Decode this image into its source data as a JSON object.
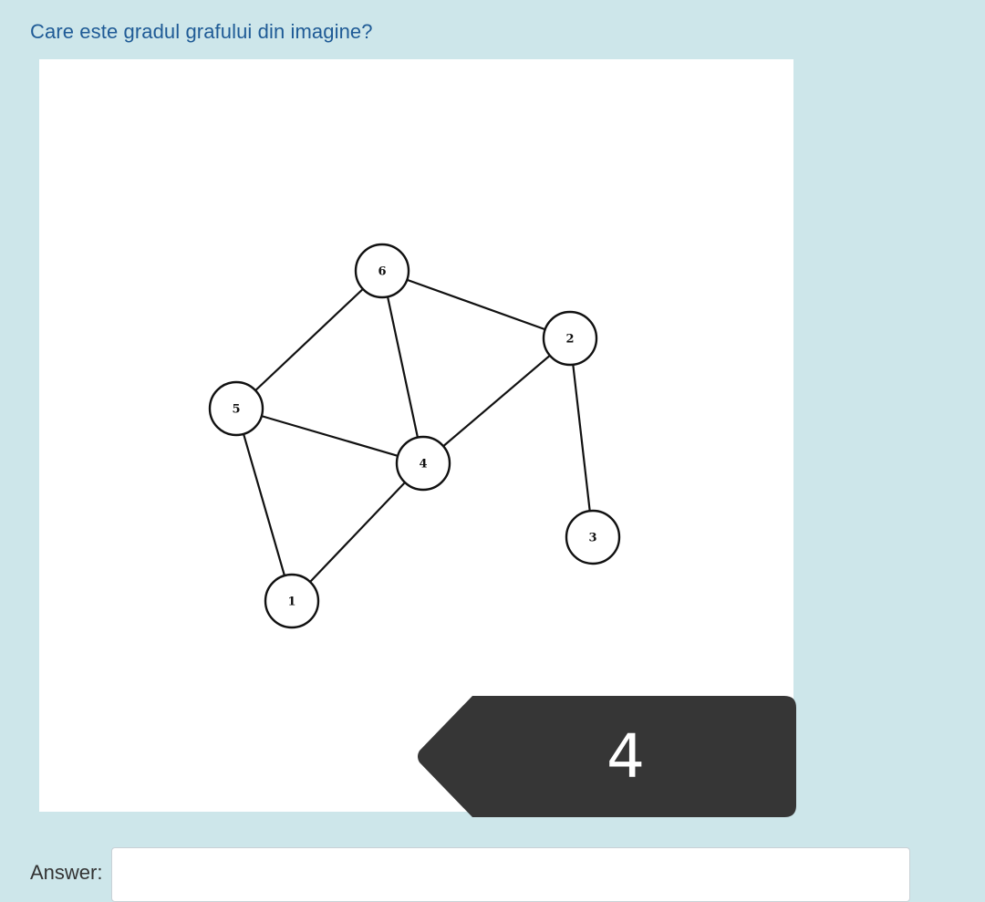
{
  "question": {
    "text": "Care este gradul grafului din imagine?"
  },
  "graph": {
    "nodes": [
      {
        "id": "6",
        "label": "6"
      },
      {
        "id": "2",
        "label": "2"
      },
      {
        "id": "5",
        "label": "5"
      },
      {
        "id": "4",
        "label": "4"
      },
      {
        "id": "3",
        "label": "3"
      },
      {
        "id": "1",
        "label": "1"
      }
    ],
    "edges": [
      [
        "6",
        "2"
      ],
      [
        "6",
        "5"
      ],
      [
        "6",
        "4"
      ],
      [
        "5",
        "4"
      ],
      [
        "5",
        "1"
      ],
      [
        "4",
        "2"
      ],
      [
        "4",
        "1"
      ],
      [
        "2",
        "3"
      ]
    ]
  },
  "answer_badge": {
    "value": "4"
  },
  "answer": {
    "label": "Answer:",
    "value": "",
    "placeholder": ""
  },
  "colors": {
    "page_background": "#cde6ea",
    "question_text": "#1f5b96",
    "badge_background": "#363636",
    "badge_text": "#ffffff"
  }
}
